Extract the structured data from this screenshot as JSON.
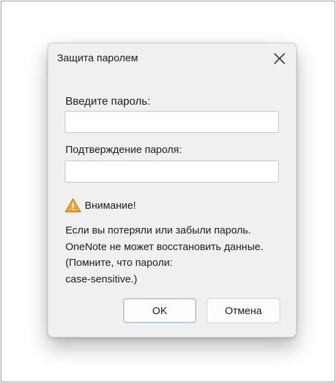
{
  "dialog": {
    "title": "Защита паролем",
    "close_icon": "close-icon"
  },
  "fields": {
    "password_label": "Введите пароль:",
    "password_value": "",
    "confirm_label": "Подтверждение пароля:",
    "confirm_value": ""
  },
  "warning": {
    "icon": "warning-icon",
    "title": "Внимание!",
    "lines": [
      "Если вы потеряли или забыли пароль.",
      "OneNote не может восстановить данные.",
      "(Помните, что пароли:",
      "case-sensitive.)"
    ]
  },
  "buttons": {
    "ok_label": "OK",
    "cancel_label": "Отмена"
  },
  "colors": {
    "dialog_bg": "#f0f0f0",
    "warning_fill": "#f0a830",
    "ok_border": "#a3bcd4"
  }
}
